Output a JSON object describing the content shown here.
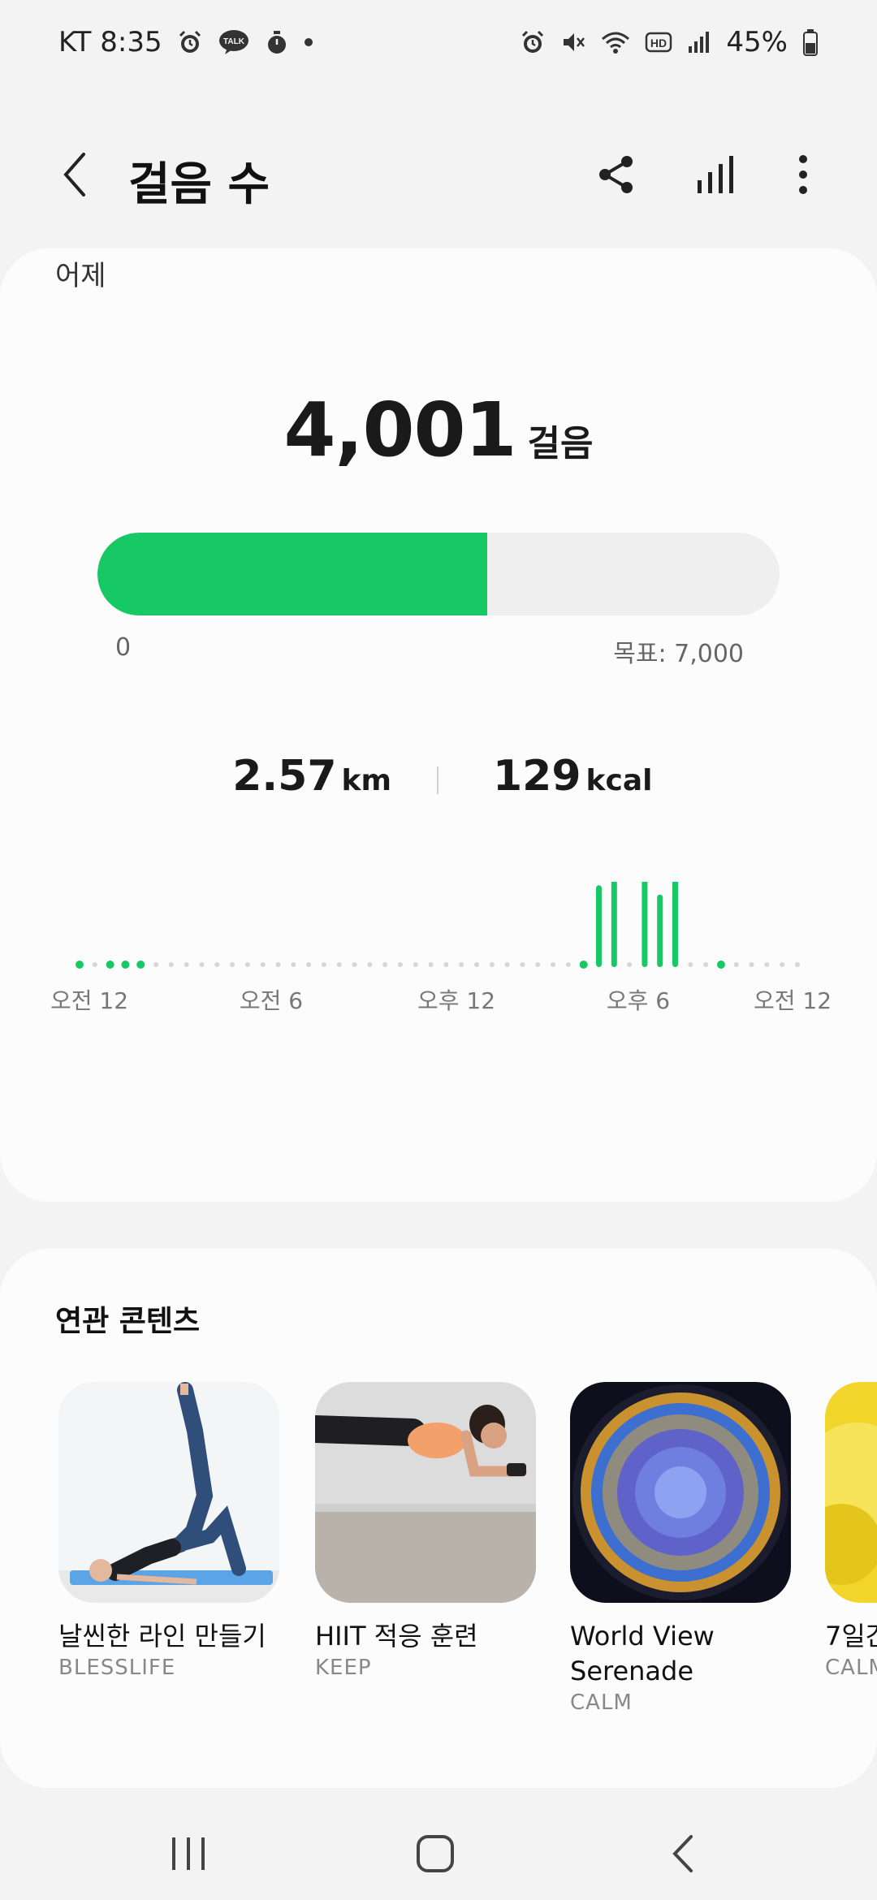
{
  "status_bar": {
    "carrier_time": "KT 8:35",
    "talk_label": "TALK",
    "network_label": "HD",
    "battery": "45%"
  },
  "app_bar": {
    "title": "걸음 수",
    "icons": [
      "back-arrow-icon",
      "share-icon",
      "bar-chart-icon",
      "more-vert-icon"
    ]
  },
  "summary": {
    "day": "어제",
    "steps": "4,001",
    "steps_unit": "걸음",
    "progress_fraction": 0.5716,
    "progress_min": "0",
    "progress_goal": "목표: 7,000",
    "distance_value": "2.57",
    "distance_unit": "km",
    "calories_value": "129",
    "calories_unit": "kcal"
  },
  "chart_data": {
    "type": "bar",
    "x_tick_labels": [
      "오전 12",
      "오전 6",
      "오후 12",
      "오후 6",
      "오전 12"
    ],
    "slots_per_hour": 2,
    "values": [
      0.03,
      0,
      0.03,
      0.03,
      0.03,
      0,
      0,
      0,
      0,
      0,
      0,
      0,
      0,
      0,
      0,
      0,
      0,
      0,
      0,
      0,
      0,
      0,
      0,
      0,
      0,
      0,
      0,
      0,
      0,
      0,
      0,
      0,
      0,
      0.03,
      0.53,
      0.7,
      0,
      0.98,
      0.47,
      0.59,
      0,
      0,
      0.03,
      0,
      0,
      0,
      0,
      0
    ],
    "color": "#17c964",
    "empty_color": "#d6d6d6"
  },
  "related": {
    "title": "연관 콘텐츠",
    "items": [
      {
        "title": "날씬한 라인 만들기",
        "source": "BLESSLIFE"
      },
      {
        "title": "HIIT 적응 훈련",
        "source": "KEEP"
      },
      {
        "title": "World View\nSerenade",
        "source": "CALM"
      },
      {
        "title": "7일간",
        "source": "CALM"
      }
    ]
  },
  "nav_bar": {
    "icons": [
      "recents-icon",
      "home-icon",
      "back-icon"
    ]
  },
  "colors": {
    "accent": "#17c964",
    "background": "#f3f3f3",
    "card": "#fcfcfc"
  }
}
